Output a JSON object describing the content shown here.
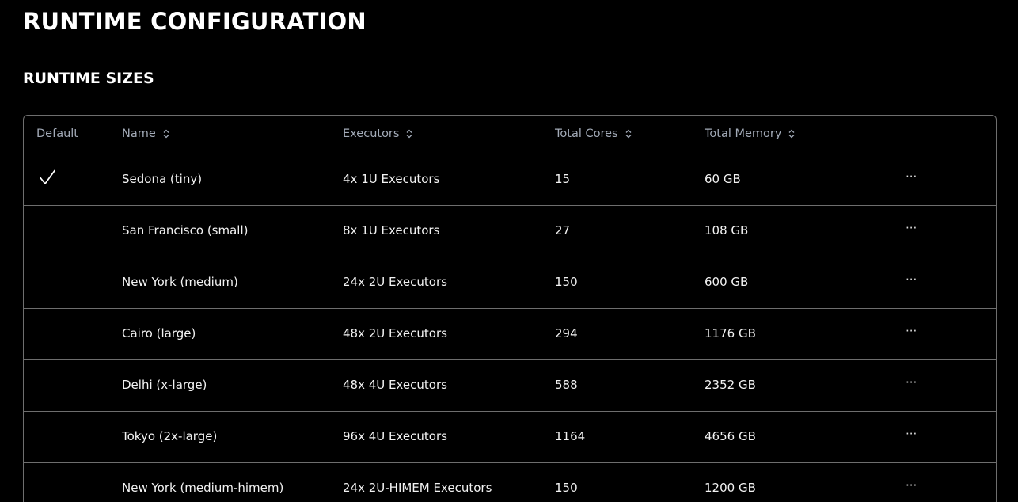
{
  "page": {
    "title": "RUNTIME CONFIGURATION",
    "section_title": "RUNTIME SIZES"
  },
  "table": {
    "columns": {
      "default": "Default",
      "name": "Name",
      "executors": "Executors",
      "total_cores": "Total Cores",
      "total_memory": "Total Memory"
    },
    "rows": [
      {
        "is_default": true,
        "name": "Sedona (tiny)",
        "executors": "4x 1U Executors",
        "cores": "15",
        "memory": "60 GB",
        "actions": "···"
      },
      {
        "is_default": false,
        "name": "San Francisco (small)",
        "executors": "8x 1U Executors",
        "cores": "27",
        "memory": "108 GB",
        "actions": "···"
      },
      {
        "is_default": false,
        "name": "New York (medium)",
        "executors": "24x 2U Executors",
        "cores": "150",
        "memory": "600 GB",
        "actions": "···"
      },
      {
        "is_default": false,
        "name": "Cairo (large)",
        "executors": "48x 2U Executors",
        "cores": "294",
        "memory": "1176 GB",
        "actions": "···"
      },
      {
        "is_default": false,
        "name": "Delhi (x-large)",
        "executors": "48x 4U Executors",
        "cores": "588",
        "memory": "2352 GB",
        "actions": "···"
      },
      {
        "is_default": false,
        "name": "Tokyo (2x-large)",
        "executors": "96x 4U Executors",
        "cores": "1164",
        "memory": "4656 GB",
        "actions": "···"
      },
      {
        "is_default": false,
        "name": "New York (medium-himem)",
        "executors": "24x 2U-HIMEM Executors",
        "cores": "150",
        "memory": "1200 GB",
        "actions": "···"
      }
    ]
  },
  "icons": {
    "sort": "sort-icon",
    "default_marker": "check-icon",
    "row_menu": "more-icon"
  },
  "colors": {
    "background": "#000000",
    "text": "#ffffff",
    "header_text": "#a3abb8",
    "border": "#6e6e6e"
  }
}
